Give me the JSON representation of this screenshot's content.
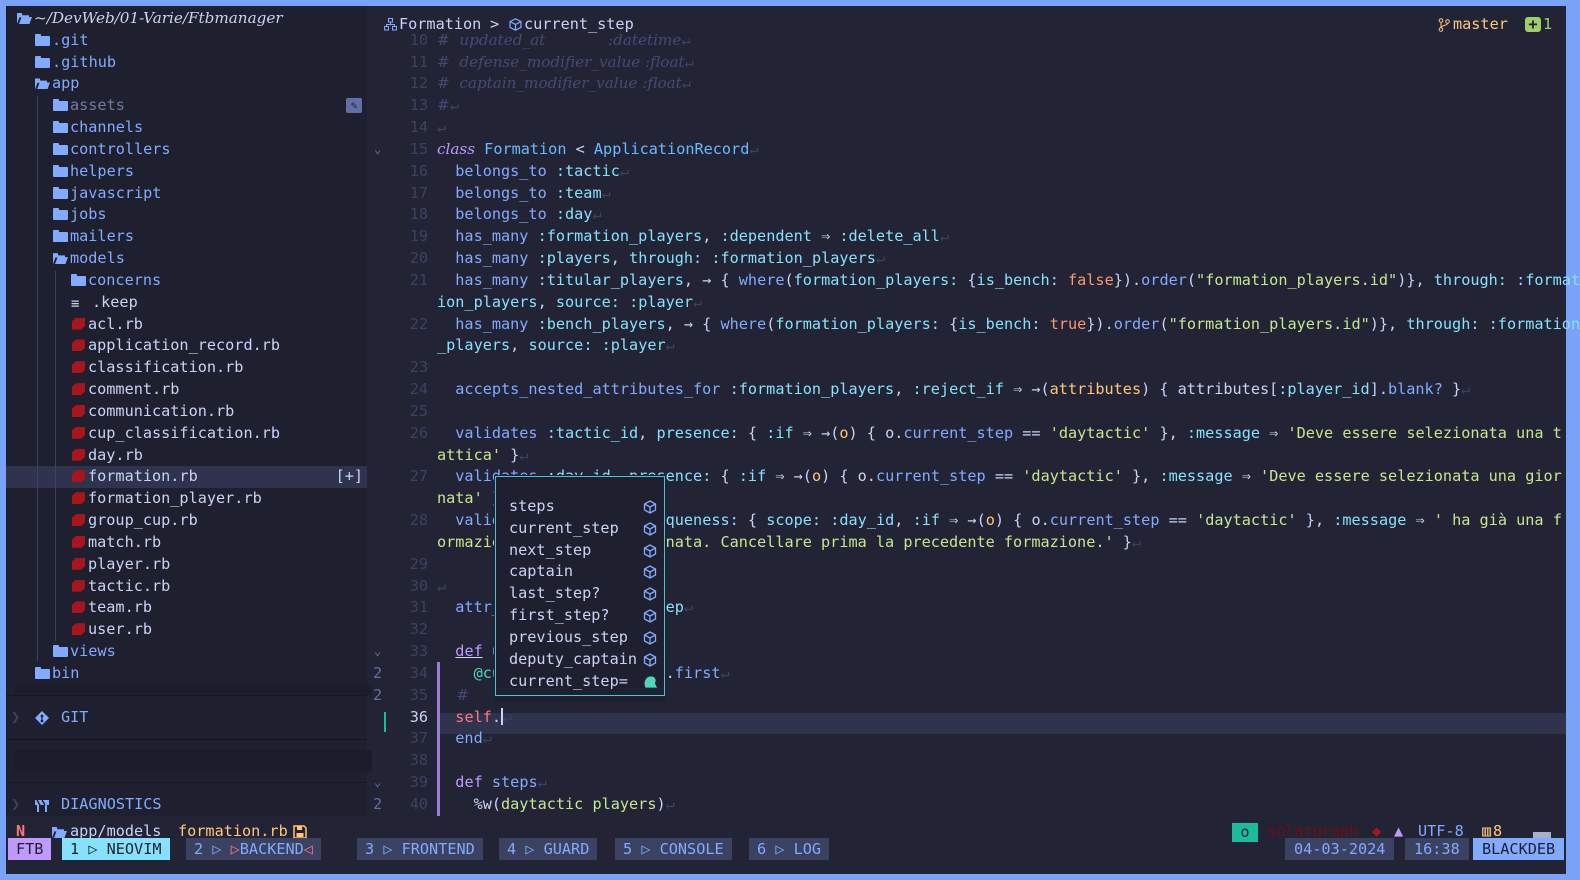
{
  "sidebar": {
    "root": "~/DevWeb/01-Varie/Ftbmanager",
    "items": [
      {
        "name": ".git",
        "type": "folder",
        "level": 1
      },
      {
        "name": ".github",
        "type": "folder",
        "level": 1
      },
      {
        "name": "app",
        "type": "folder-open",
        "level": 1
      },
      {
        "name": "assets",
        "type": "folder",
        "level": 2,
        "dim": true,
        "edit_icon": true
      },
      {
        "name": "channels",
        "type": "folder",
        "level": 2
      },
      {
        "name": "controllers",
        "type": "folder",
        "level": 2
      },
      {
        "name": "helpers",
        "type": "folder",
        "level": 2
      },
      {
        "name": "javascript",
        "type": "folder",
        "level": 2
      },
      {
        "name": "jobs",
        "type": "folder",
        "level": 2
      },
      {
        "name": "mailers",
        "type": "folder",
        "level": 2
      },
      {
        "name": "models",
        "type": "folder-open",
        "level": 2
      },
      {
        "name": "concerns",
        "type": "folder",
        "level": 3
      },
      {
        "name": ".keep",
        "type": "file",
        "level": 3
      },
      {
        "name": "acl.rb",
        "type": "ruby",
        "level": 3
      },
      {
        "name": "application_record.rb",
        "type": "ruby",
        "level": 3
      },
      {
        "name": "classification.rb",
        "type": "ruby",
        "level": 3
      },
      {
        "name": "comment.rb",
        "type": "ruby",
        "level": 3
      },
      {
        "name": "communication.rb",
        "type": "ruby",
        "level": 3
      },
      {
        "name": "cup_classification.rb",
        "type": "ruby",
        "level": 3
      },
      {
        "name": "day.rb",
        "type": "ruby",
        "level": 3
      },
      {
        "name": "formation.rb",
        "type": "ruby",
        "level": 3,
        "selected": true,
        "badge": "[+]"
      },
      {
        "name": "formation_player.rb",
        "type": "ruby",
        "level": 3
      },
      {
        "name": "group_cup.rb",
        "type": "ruby",
        "level": 3
      },
      {
        "name": "match.rb",
        "type": "ruby",
        "level": 3
      },
      {
        "name": "player.rb",
        "type": "ruby",
        "level": 3
      },
      {
        "name": "tactic.rb",
        "type": "ruby",
        "level": 3
      },
      {
        "name": "team.rb",
        "type": "ruby",
        "level": 3
      },
      {
        "name": "user.rb",
        "type": "ruby",
        "level": 3
      },
      {
        "name": "views",
        "type": "folder",
        "level": 2
      },
      {
        "name": "bin",
        "type": "folder",
        "level": 1
      }
    ],
    "git_label": "GIT",
    "diagnostics_label": "DIAGNOSTICS"
  },
  "breadcrumb": {
    "class": "Formation",
    "sep": ">",
    "method": "current_step"
  },
  "git": {
    "branch": "master",
    "added": "1"
  },
  "editor": {
    "current_line": "36",
    "rows": [
      {
        "n": "10",
        "tok": [
          [
            "#  updated_at             :datetime",
            "c"
          ],
          [
            "↵",
            "e"
          ]
        ]
      },
      {
        "n": "11",
        "tok": [
          [
            "#  defense_modifier_value :float",
            "c"
          ],
          [
            "↵",
            "e"
          ]
        ]
      },
      {
        "n": "12",
        "tok": [
          [
            "#  captain_modifier_value :float",
            "c"
          ],
          [
            "↵",
            "e"
          ]
        ]
      },
      {
        "n": "13",
        "tok": [
          [
            "#",
            "c"
          ],
          [
            "↵",
            "e"
          ]
        ]
      },
      {
        "n": "14",
        "tok": [
          [
            "↵",
            "e"
          ]
        ]
      },
      {
        "n": "15",
        "fold": true,
        "tok": [
          [
            "class",
            "ki"
          ],
          [
            " ",
            "n"
          ],
          [
            "Formation",
            "t"
          ],
          [
            " < ",
            "n"
          ],
          [
            "ApplicationRecord",
            "t"
          ],
          [
            "↵",
            "e"
          ]
        ]
      },
      {
        "n": "16",
        "tok": [
          [
            "  belongs_to ",
            "f"
          ],
          [
            ":tactic",
            "s"
          ],
          [
            "↵",
            "e"
          ]
        ]
      },
      {
        "n": "17",
        "tok": [
          [
            "  belongs_to ",
            "f"
          ],
          [
            ":team",
            "s"
          ],
          [
            "↵",
            "e"
          ]
        ]
      },
      {
        "n": "18",
        "tok": [
          [
            "  belongs_to ",
            "f"
          ],
          [
            ":day",
            "s"
          ],
          [
            "↵",
            "e"
          ]
        ]
      },
      {
        "n": "19",
        "tok": [
          [
            "  has_many ",
            "f"
          ],
          [
            ":formation_players",
            "s"
          ],
          [
            ", ",
            "n"
          ],
          [
            ":dependent",
            "s"
          ],
          [
            " ⇒ ",
            "n"
          ],
          [
            ":delete_all",
            "s"
          ],
          [
            "↵",
            "e"
          ]
        ]
      },
      {
        "n": "20",
        "tok": [
          [
            "  has_many ",
            "f"
          ],
          [
            ":players",
            "s"
          ],
          [
            ", ",
            "n"
          ],
          [
            "through:",
            "s"
          ],
          [
            " ",
            "n"
          ],
          [
            ":formation_players",
            "s"
          ],
          [
            "↵",
            "e"
          ]
        ]
      },
      {
        "n": "21",
        "tok": [
          [
            "  has_many ",
            "f"
          ],
          [
            ":titular_players",
            "s"
          ],
          [
            ", → { ",
            "n"
          ],
          [
            "where",
            "f"
          ],
          [
            "(",
            "n"
          ],
          [
            "formation_players:",
            "s"
          ],
          [
            " {",
            "n"
          ],
          [
            "is_bench:",
            "s"
          ],
          [
            " ",
            "n"
          ],
          [
            "false",
            "b"
          ],
          [
            "}).",
            "n"
          ],
          [
            "order",
            "f"
          ],
          [
            "(",
            "n"
          ],
          [
            "\"formation_players.id\"",
            "st"
          ],
          [
            ")}, ",
            "n"
          ],
          [
            "through:",
            "s"
          ],
          [
            " ",
            "n"
          ],
          [
            ":format",
            "s"
          ]
        ]
      },
      {
        "n": "",
        "tok": [
          [
            "ion_players",
            "s"
          ],
          [
            ", ",
            "n"
          ],
          [
            "source:",
            "s"
          ],
          [
            " ",
            "n"
          ],
          [
            ":player",
            "s"
          ],
          [
            "↵",
            "e"
          ]
        ]
      },
      {
        "n": "22",
        "tok": [
          [
            "  has_many ",
            "f"
          ],
          [
            ":bench_players",
            "s"
          ],
          [
            ", → { ",
            "n"
          ],
          [
            "where",
            "f"
          ],
          [
            "(",
            "n"
          ],
          [
            "formation_players:",
            "s"
          ],
          [
            " {",
            "n"
          ],
          [
            "is_bench:",
            "s"
          ],
          [
            " ",
            "n"
          ],
          [
            "true",
            "b"
          ],
          [
            "}).",
            "n"
          ],
          [
            "order",
            "f"
          ],
          [
            "(",
            "n"
          ],
          [
            "\"formation_players.id\"",
            "st"
          ],
          [
            ")}, ",
            "n"
          ],
          [
            "through:",
            "s"
          ],
          [
            " ",
            "n"
          ],
          [
            ":formation",
            "s"
          ]
        ]
      },
      {
        "n": "",
        "tok": [
          [
            "_players",
            "s"
          ],
          [
            ", ",
            "n"
          ],
          [
            "source:",
            "s"
          ],
          [
            " ",
            "n"
          ],
          [
            ":player",
            "s"
          ],
          [
            "↵",
            "e"
          ]
        ]
      },
      {
        "n": "23",
        "tok": []
      },
      {
        "n": "24",
        "tok": [
          [
            "  accepts_nested_attributes_for ",
            "f"
          ],
          [
            ":formation_players",
            "s"
          ],
          [
            ", ",
            "n"
          ],
          [
            ":reject_if",
            "s"
          ],
          [
            " ⇒ →(",
            "n"
          ],
          [
            "attributes",
            "v"
          ],
          [
            ") { attributes[",
            "n"
          ],
          [
            ":player_id",
            "s"
          ],
          [
            "].",
            "n"
          ],
          [
            "blank?",
            "f"
          ],
          [
            " }",
            "n"
          ],
          [
            "↵",
            "e"
          ]
        ]
      },
      {
        "n": "25",
        "tok": []
      },
      {
        "n": "26",
        "tok": [
          [
            "  validates ",
            "f"
          ],
          [
            ":tactic_id",
            "s"
          ],
          [
            ", ",
            "n"
          ],
          [
            "presence:",
            "s"
          ],
          [
            " { ",
            "n"
          ],
          [
            ":if",
            "s"
          ],
          [
            " ⇒ →(",
            "n"
          ],
          [
            "o",
            "v"
          ],
          [
            ") { o.",
            "n"
          ],
          [
            "current_step",
            "f"
          ],
          [
            " == ",
            "n"
          ],
          [
            "'daytactic'",
            "st"
          ],
          [
            " }, ",
            "n"
          ],
          [
            ":message",
            "s"
          ],
          [
            " ⇒ ",
            "n"
          ],
          [
            "'Deve essere selezionata una t",
            "st"
          ]
        ]
      },
      {
        "n": "",
        "tok": [
          [
            "attica'",
            "st"
          ],
          [
            " }",
            "n"
          ],
          [
            "↵",
            "e"
          ]
        ]
      },
      {
        "n": "27",
        "tok": [
          [
            "  validates ",
            "f"
          ],
          [
            ":day_id",
            "s"
          ],
          [
            ", ",
            "n"
          ],
          [
            "presence:",
            "s"
          ],
          [
            " { ",
            "n"
          ],
          [
            ":if",
            "s"
          ],
          [
            " ⇒ →(",
            "n"
          ],
          [
            "o",
            "v"
          ],
          [
            ") { o.",
            "n"
          ],
          [
            "current_step",
            "f"
          ],
          [
            " == ",
            "n"
          ],
          [
            "'daytactic'",
            "st"
          ],
          [
            " }, ",
            "n"
          ],
          [
            ":message",
            "s"
          ],
          [
            " ⇒ ",
            "n"
          ],
          [
            "'Deve essere selezionata una gior",
            "st"
          ]
        ]
      },
      {
        "n": "",
        "tok": [
          [
            "nata'",
            "st"
          ],
          [
            " }",
            "n"
          ],
          [
            "↵",
            "e"
          ]
        ]
      },
      {
        "n": "28",
        "tok": [
          [
            "  validates ",
            "f"
          ],
          [
            ":team_id",
            "s"
          ],
          [
            ", ",
            "n"
          ],
          [
            "uniqueness:",
            "s"
          ],
          [
            " { ",
            "n"
          ],
          [
            "scope:",
            "s"
          ],
          [
            " ",
            "n"
          ],
          [
            ":day_id",
            "s"
          ],
          [
            ", ",
            "n"
          ],
          [
            ":if",
            "s"
          ],
          [
            " ⇒ →(",
            "n"
          ],
          [
            "o",
            "v"
          ],
          [
            ") { o.",
            "n"
          ],
          [
            "current_step",
            "f"
          ],
          [
            " == ",
            "n"
          ],
          [
            "'daytactic'",
            "st"
          ],
          [
            " }, ",
            "n"
          ],
          [
            ":message",
            "s"
          ],
          [
            " ⇒ ",
            "n"
          ],
          [
            "' ha già una f",
            "st"
          ]
        ]
      },
      {
        "n": "",
        "tok": [
          [
            "ormazione per questa giornata. Cancellare prima la precedente formazione.'",
            "st"
          ],
          [
            " }",
            "n"
          ],
          [
            "↵",
            "e"
          ]
        ]
      },
      {
        "n": "29",
        "tok": []
      },
      {
        "n": "30",
        "tok": [
          [
            "↵",
            "e"
          ]
        ]
      },
      {
        "n": "31",
        "tok": [
          [
            "  attr_writer ",
            "f"
          ],
          [
            ":current_step",
            "s"
          ],
          [
            "↵",
            "e"
          ]
        ]
      },
      {
        "n": "32",
        "tok": []
      },
      {
        "n": "33",
        "fold": true,
        "tok": [
          [
            "  ",
            "n"
          ],
          [
            "def",
            "k u"
          ],
          [
            " update_step",
            "f"
          ]
        ]
      },
      {
        "n": "34",
        "sign": "2",
        "tok": [
          [
            "    ",
            "n"
          ],
          [
            "@current_step",
            "iv"
          ],
          [
            " = ",
            "n"
          ],
          [
            "steps",
            "f"
          ],
          [
            ".",
            "n"
          ],
          [
            "first",
            "f"
          ],
          [
            "↵",
            "e"
          ]
        ]
      },
      {
        "n": "35",
        "sign": "2",
        "tok": [
          [
            "    # ",
            "c"
          ]
        ]
      },
      {
        "n": "36",
        "cursor": true,
        "tok": [
          [
            "  ",
            "n"
          ],
          [
            "self",
            "r"
          ],
          [
            ".",
            "n"
          ]
        ]
      },
      {
        "n": "37",
        "tok": [
          [
            "  end",
            "f"
          ],
          [
            "↵",
            "e"
          ]
        ]
      },
      {
        "n": "38",
        "tok": []
      },
      {
        "n": "39",
        "fold": true,
        "tok": [
          [
            "  ",
            "n"
          ],
          [
            "def",
            "k"
          ],
          [
            " ",
            "n"
          ],
          [
            "steps",
            "f"
          ],
          [
            "↵",
            "e"
          ]
        ]
      },
      {
        "n": "40",
        "sign": "2",
        "tok": [
          [
            "    ",
            "n"
          ],
          [
            "%w(",
            "n"
          ],
          [
            "daytactic players",
            "st"
          ],
          [
            ")",
            "n"
          ],
          [
            "↵",
            "e"
          ]
        ]
      }
    ]
  },
  "completion": {
    "items": [
      {
        "label": "steps",
        "kind": "method-icon"
      },
      {
        "label": "current_step",
        "kind": "method-icon"
      },
      {
        "label": "next_step",
        "kind": "method-icon"
      },
      {
        "label": "captain",
        "kind": "method-icon"
      },
      {
        "label": "last_step?",
        "kind": "method-icon"
      },
      {
        "label": "first_step?",
        "kind": "method-icon"
      },
      {
        "label": "previous_step",
        "kind": "method-icon"
      },
      {
        "label": "deputy_captain",
        "kind": "method-icon"
      },
      {
        "label": "current_step=",
        "kind": "snippet-icon"
      }
    ]
  },
  "statusline": {
    "mode_icon": "N",
    "path": "app/models",
    "file": "formation.rb",
    "lsp_status": "o",
    "lsp_name": "solargraph",
    "encoding": "UTF-8",
    "indent": "8"
  },
  "tabline": {
    "session": "FTB",
    "windows": [
      {
        "index": "1",
        "name": "NEOVIM",
        "active": true
      },
      {
        "index": "2",
        "name": "BACKEND",
        "marked": true
      },
      {
        "index": "3",
        "name": "FRONTEND"
      },
      {
        "index": "4",
        "name": "GUARD"
      },
      {
        "index": "5",
        "name": "CONSOLE"
      },
      {
        "index": "6",
        "name": "LOG"
      }
    ],
    "date": "04-03-2024",
    "time": "16:38",
    "host": "BLACKDEB"
  },
  "colors": {
    "background": "#222436",
    "sidebar": "#1e2030",
    "accent": "#7aa2f7",
    "cyan": "#86e1fc",
    "purple": "#c099ff",
    "green": "#c3e88d",
    "orange": "#ff966c"
  }
}
